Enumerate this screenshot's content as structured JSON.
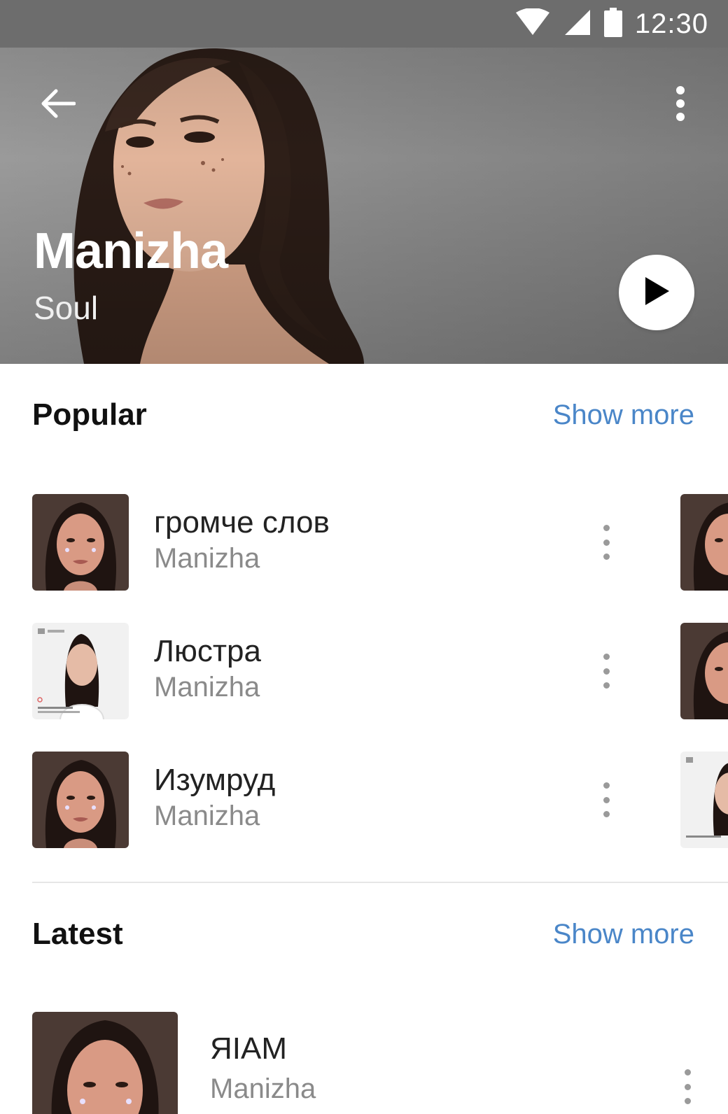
{
  "status_bar": {
    "time": "12:30",
    "icons": [
      "wifi-icon",
      "signal-icon",
      "battery-icon"
    ]
  },
  "header": {
    "artist_name": "Manizha",
    "genre": "Soul",
    "icons": {
      "back": "arrow-left-icon",
      "more": "more-vertical-icon",
      "play": "play-icon"
    }
  },
  "popular": {
    "title": "Popular",
    "show_more": "Show more",
    "tracks": [
      {
        "title": "громче слов",
        "artist": "Manizha",
        "cover": "portrait-dark"
      },
      {
        "title": "Люстра",
        "artist": "Manizha",
        "cover": "portrait-white"
      },
      {
        "title": "Изумруд",
        "artist": "Manizha",
        "cover": "portrait-dark"
      }
    ]
  },
  "latest": {
    "title": "Latest",
    "show_more": "Show more",
    "tracks": [
      {
        "title": "ЯIAM",
        "artist": "Manizha",
        "cover": "portrait-dark"
      }
    ]
  },
  "colors": {
    "accent": "#4a86c8",
    "secondary_text": "#8a8a8a",
    "status_bar": "#6d6d6d"
  }
}
